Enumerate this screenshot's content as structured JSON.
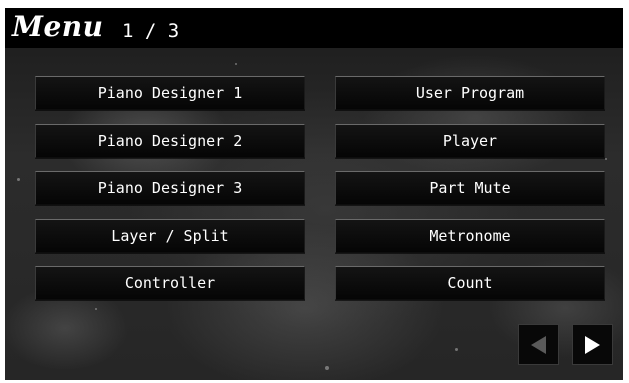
{
  "header": {
    "title": "Menu",
    "page_indicator": "1 / 3"
  },
  "menu": {
    "left": [
      "Piano Designer 1",
      "Piano Designer 2",
      "Piano Designer 3",
      "Layer / Split",
      "Controller"
    ],
    "right": [
      "User Program",
      "Player",
      "Part Mute",
      "Metronome",
      "Count"
    ]
  },
  "navigation": {
    "prev_icon": "triangle-left-icon",
    "next_icon": "triangle-right-icon",
    "prev_enabled": false,
    "next_enabled": true
  }
}
